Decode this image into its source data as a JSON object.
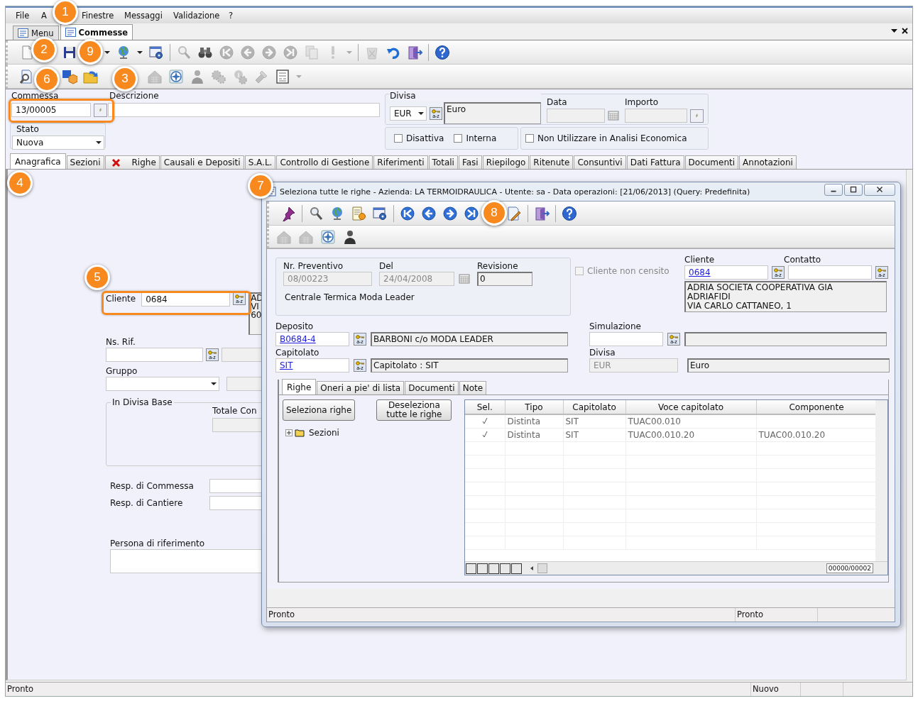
{
  "menu_bar": [
    {
      "label": "File"
    },
    {
      "label": "A"
    },
    {
      "label": "Finestre"
    },
    {
      "label": "Messaggi"
    },
    {
      "label": "Validazione"
    },
    {
      "label": "?"
    }
  ],
  "document_tabs": [
    {
      "label": "Menu",
      "selected": false
    },
    {
      "label": "Commesse",
      "selected": true
    }
  ],
  "main_toolbar": [
    {
      "kind": "new",
      "disabled": false
    },
    {
      "kind": "spacer"
    },
    {
      "kind": "save",
      "disabled": false
    },
    {
      "kind": "spacer"
    },
    {
      "kind": "caret",
      "disabled": false
    },
    {
      "kind": "globe",
      "disabled": false
    },
    {
      "kind": "caret",
      "disabled": false
    },
    {
      "kind": "window-gear",
      "disabled": false
    },
    {
      "kind": "sep"
    },
    {
      "kind": "search",
      "disabled": true
    },
    {
      "kind": "binoculars",
      "disabled": false
    },
    {
      "kind": "first",
      "disabled": true
    },
    {
      "kind": "prev",
      "disabled": true
    },
    {
      "kind": "next",
      "disabled": true
    },
    {
      "kind": "last",
      "disabled": true
    },
    {
      "kind": "copy",
      "disabled": true
    },
    {
      "kind": "exclam",
      "disabled": true
    },
    {
      "kind": "caret",
      "disabled": true
    },
    {
      "kind": "sep"
    },
    {
      "kind": "trash",
      "disabled": true
    },
    {
      "kind": "undo",
      "disabled": false
    },
    {
      "kind": "exit",
      "disabled": false
    },
    {
      "kind": "sep"
    },
    {
      "kind": "help",
      "disabled": false
    }
  ],
  "secondary_toolbar": [
    {
      "kind": "search-doc",
      "disabled": false
    },
    {
      "kind": "spacer"
    },
    {
      "kind": "ep",
      "disabled": false
    },
    {
      "kind": "folder",
      "disabled": false
    },
    {
      "kind": "spacer"
    },
    {
      "kind": "spacer"
    },
    {
      "kind": "house",
      "disabled": true
    },
    {
      "kind": "compass",
      "disabled": false
    },
    {
      "kind": "person",
      "disabled": true
    },
    {
      "kind": "gears",
      "disabled": true
    },
    {
      "kind": "info-gear",
      "disabled": true
    },
    {
      "kind": "tools",
      "disabled": true
    },
    {
      "kind": "form",
      "disabled": false
    },
    {
      "kind": "caret",
      "disabled": true
    }
  ],
  "header": {
    "commessa": {
      "label": "Commessa",
      "value": "13/00005"
    },
    "descrizione": {
      "label": "Descrizione"
    },
    "stato": {
      "label": "Stato",
      "value": "Nuova"
    },
    "divisa": {
      "label": "Divisa",
      "code": "EUR",
      "name": "Euro",
      "lookup": "a-z"
    },
    "data": {
      "label": "Data"
    },
    "importo": {
      "label": "Importo"
    },
    "checkboxes": [
      {
        "label": "Disattiva",
        "checked": false
      },
      {
        "label": "Interna",
        "checked": false
      },
      {
        "label": "Non Utilizzare in Analisi Economica",
        "checked": false
      }
    ]
  },
  "tabs": [
    {
      "label": "Anagrafica",
      "selected": true,
      "error": false
    },
    {
      "label": "Sezioni",
      "selected": false,
      "error": false
    },
    {
      "label": "Righe",
      "selected": false,
      "error": true
    },
    {
      "label": "Causali e Depositi",
      "selected": false,
      "error": false
    },
    {
      "label": "S.A.L.",
      "selected": false,
      "error": false
    },
    {
      "label": "Controllo di Gestione",
      "selected": false,
      "error": false
    },
    {
      "label": "Riferimenti",
      "selected": false,
      "error": false
    },
    {
      "label": "Totali",
      "selected": false,
      "error": false
    },
    {
      "label": "Fasi",
      "selected": false,
      "error": false
    },
    {
      "label": "Riepilogo",
      "selected": false,
      "error": false
    },
    {
      "label": "Ritenute",
      "selected": false,
      "error": false
    },
    {
      "label": "Consuntivi",
      "selected": false,
      "error": false
    },
    {
      "label": "Dati Fattura",
      "selected": false,
      "error": false
    },
    {
      "label": "Documenti",
      "selected": false,
      "error": false
    },
    {
      "label": "Annotazioni",
      "selected": false,
      "error": false
    }
  ],
  "anagrafica": {
    "cliente": {
      "label": "Cliente",
      "value": "0684",
      "lookup": "a-z",
      "address": [
        "AD",
        "VI",
        "60"
      ]
    },
    "ns_rif": {
      "label": "Ns. Rif.",
      "lookup": "a-z"
    },
    "gruppo": {
      "label": "Gruppo"
    },
    "in_divisa_base": {
      "title": "In Divisa Base",
      "totale_label": "Totale Con"
    },
    "resp_commessa": {
      "label": "Resp. di Commessa"
    },
    "resp_cantiere": {
      "label": "Resp. di Cantiere"
    },
    "persona": {
      "label": "Persona di riferimento"
    }
  },
  "status_bar": {
    "message": "Pronto",
    "mode": "Nuovo"
  },
  "dialog": {
    "title": "Seleziona tutte le righe - Azienda: LA TERMOIDRAULICA - Utente: sa - Data operazioni: [21/06/2013] (Query: Predefinita)",
    "toolbar": [
      {
        "kind": "pin",
        "disabled": false
      },
      {
        "kind": "sep"
      },
      {
        "kind": "search",
        "disabled": false
      },
      {
        "kind": "globe",
        "disabled": false
      },
      {
        "kind": "notes",
        "disabled": false
      },
      {
        "kind": "window-gear",
        "disabled": false
      },
      {
        "kind": "sep"
      },
      {
        "kind": "first",
        "disabled": false
      },
      {
        "kind": "prev",
        "disabled": false
      },
      {
        "kind": "next",
        "disabled": false
      },
      {
        "kind": "last",
        "disabled": false
      },
      {
        "kind": "spacer"
      },
      {
        "kind": "doc-edit",
        "disabled": false
      },
      {
        "kind": "sep"
      },
      {
        "kind": "exit",
        "disabled": false
      },
      {
        "kind": "sep"
      },
      {
        "kind": "help",
        "disabled": false
      }
    ],
    "toolbar2": [
      {
        "kind": "house",
        "disabled": true
      },
      {
        "kind": "house",
        "disabled": true
      },
      {
        "kind": "compass",
        "disabled": false
      },
      {
        "kind": "person",
        "disabled": false
      }
    ],
    "preventivo": {
      "nr_label": "Nr. Preventivo",
      "nr": "08/00223",
      "del_label": "Del",
      "del": "24/04/2008",
      "revisione_label": "Revisione",
      "revisione": "0",
      "description": "Centrale Termica Moda Leader"
    },
    "cliente_non_censito": {
      "label": "Cliente non censito",
      "checked": false
    },
    "cliente": {
      "label": "Cliente",
      "value": "0684",
      "lookup": "a-z",
      "address": [
        "ADRIA SOCIETA COOPERATIVA GIA",
        "ADRIAFIDI",
        "VIA CARLO CATTANEO, 1"
      ]
    },
    "contatto": {
      "label": "Contatto",
      "lookup": "a-z"
    },
    "deposito": {
      "label": "Deposito",
      "code": "B0684-4",
      "name": "BARBONI c/o MODA LEADER",
      "lookup": "a-z"
    },
    "simulazione": {
      "label": "Simulazione",
      "lookup": "a-z"
    },
    "capitolato": {
      "label": "Capitolato",
      "code": "SIT",
      "name": "Capitolato : SIT",
      "lookup": "a-z"
    },
    "divisa": {
      "label": "Divisa",
      "code": "EUR",
      "name": "Euro"
    },
    "tabs": [
      {
        "label": "Righe",
        "selected": true
      },
      {
        "label": "Oneri a pie' di lista",
        "selected": false
      },
      {
        "label": "Documenti",
        "selected": false
      },
      {
        "label": "Note",
        "selected": false
      }
    ],
    "buttons": [
      "Seleziona righe",
      "Deseleziona tutte le righe"
    ],
    "tree": [
      {
        "label": "Sezioni",
        "expanded": false
      }
    ],
    "grid": {
      "columns": [
        "Sel.",
        "Tipo",
        "Capitolato",
        "Voce capitolato",
        "Componente"
      ],
      "rows": [
        {
          "sel": true,
          "tipo": "Distinta",
          "capitolato": "SIT",
          "voce": "TUAC00.010"
        },
        {
          "sel": true,
          "tipo": "Distinta",
          "capitolato": "SIT",
          "voce": "TUAC00.010.20",
          "componente": "TUAC00.010.20"
        }
      ],
      "counter": "00000/00002"
    },
    "status_bar": {
      "left": "Pronto",
      "right": "Pronto"
    }
  },
  "callouts": [
    {
      "number": "1"
    },
    {
      "number": "2"
    },
    {
      "number": "9"
    },
    {
      "number": "6"
    },
    {
      "number": "3"
    },
    {
      "number": "4"
    },
    {
      "number": "7"
    },
    {
      "number": "5"
    },
    {
      "number": "8"
    }
  ]
}
